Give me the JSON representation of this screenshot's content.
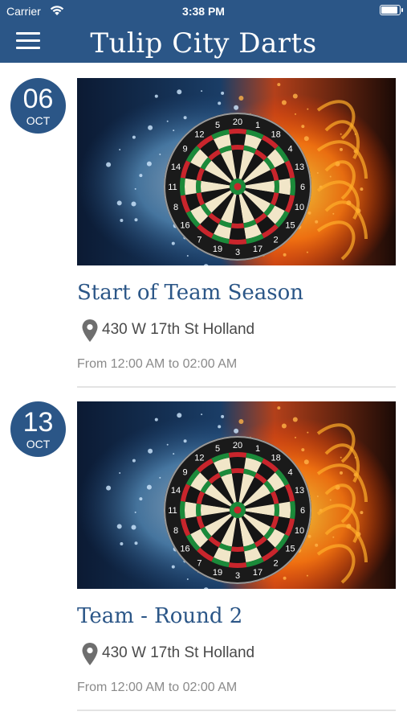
{
  "status_bar": {
    "carrier": "Carrier",
    "time": "3:38 PM",
    "battery_level": 0.95
  },
  "header": {
    "title": "Tulip City Darts",
    "menu_icon": "hamburger-menu-icon"
  },
  "colors": {
    "brand": "#2b5687",
    "muted": "#8a8a8a",
    "location_text": "#4a4a4a"
  },
  "events": [
    {
      "day": "06",
      "month": "OCT",
      "image": "dartboard-fire-water-image",
      "title": "Start of Team Season",
      "location_icon": "map-pin-icon",
      "location": "430 W 17th St Holland",
      "time": "From 12:00 AM to 02:00 AM"
    },
    {
      "day": "13",
      "month": "OCT",
      "image": "dartboard-fire-water-image",
      "title": "Team - Round 2",
      "location_icon": "map-pin-icon",
      "location": "430 W 17th St Holland",
      "time": "From 12:00 AM to 02:00 AM"
    }
  ]
}
